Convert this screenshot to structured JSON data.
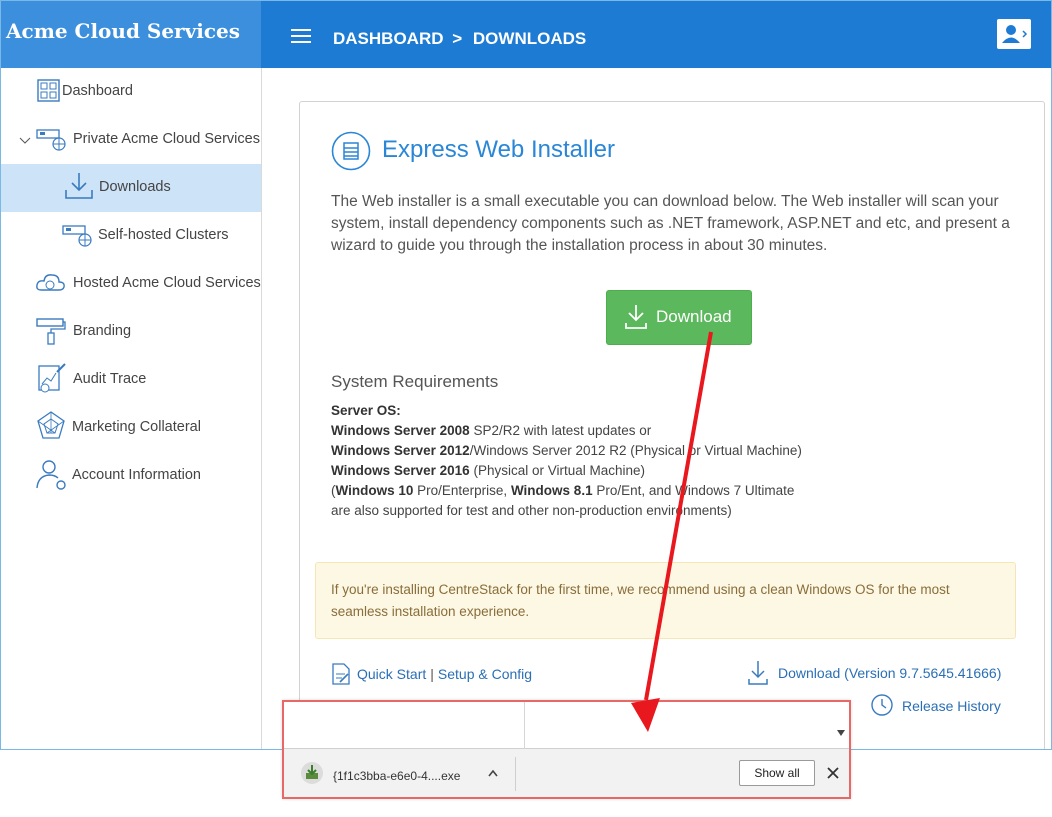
{
  "app": {
    "brand": "Acme Cloud Services",
    "breadcrumb": {
      "root": "DASHBOARD",
      "separator": ">",
      "current": "DOWNLOADS"
    }
  },
  "sidebar": {
    "items": [
      {
        "label": "Dashboard",
        "icon": "dashboard-grid-icon"
      },
      {
        "label": "Private Acme Cloud Services",
        "icon": "server-globe-icon"
      },
      {
        "label": "Downloads",
        "icon": "download-tray-icon",
        "active": true
      },
      {
        "label": "Self-hosted Clusters",
        "icon": "server-globe-icon"
      },
      {
        "label": "Hosted Acme Cloud Services",
        "icon": "cloud-globe-icon"
      },
      {
        "label": "Branding",
        "icon": "paint-roller-icon"
      },
      {
        "label": "Audit Trace",
        "icon": "audit-chart-icon"
      },
      {
        "label": "Marketing Collateral",
        "icon": "web-network-icon"
      },
      {
        "label": "Account Information",
        "icon": "user-gear-icon"
      }
    ]
  },
  "main": {
    "title": "Express Web Installer",
    "description": "The Web installer is a small executable you can download below. The Web installer will scan your system, install dependency components such as .NET framework, ASP.NET and etc, and present a wizard to guide you through the installation process in about 30 minutes.",
    "download_label": "Download",
    "sysreq_title": "System Requirements",
    "sysreq": {
      "server_os": "Server OS:",
      "l1_bold": "Windows Server 2008",
      "l1_rest": " SP2/R2 with latest updates or",
      "l2_bold": "Windows Server 2012",
      "l2_rest": "/Windows Server 2012 R2 (Physical or Virtual Machine)",
      "l3_bold": "Windows Server 2016",
      "l3_rest": " (Physical or Virtual Machine)",
      "l4_open": "(",
      "l4_b1": "Windows 10",
      "l4_mid": " Pro/Enterprise, ",
      "l4_b2": "Windows 8.1",
      "l4_rest": " Pro/Ent, and Windows 7 Ultimate",
      "l5": "are also supported for test and other non-production environments)"
    },
    "notice": "If you're installing CentreStack for the first time, we recommend using a clean Windows OS for the most seamless installation experience.",
    "quick_start": "Quick Start",
    "link_separator": "|",
    "setup_config": "Setup & Config",
    "download_version": "Download (Version 9.7.5645.41666)",
    "release_history": "Release History"
  },
  "shelf": {
    "file_name": "{1f1c3bba-e6e0-4....exe",
    "show_all": "Show all"
  },
  "colors": {
    "topbar": "#1e7bd4",
    "brand_bg": "#3b8fdc",
    "download_button": "#5cb85c",
    "link": "#2a6fb5",
    "annotation": "#e8181e"
  }
}
